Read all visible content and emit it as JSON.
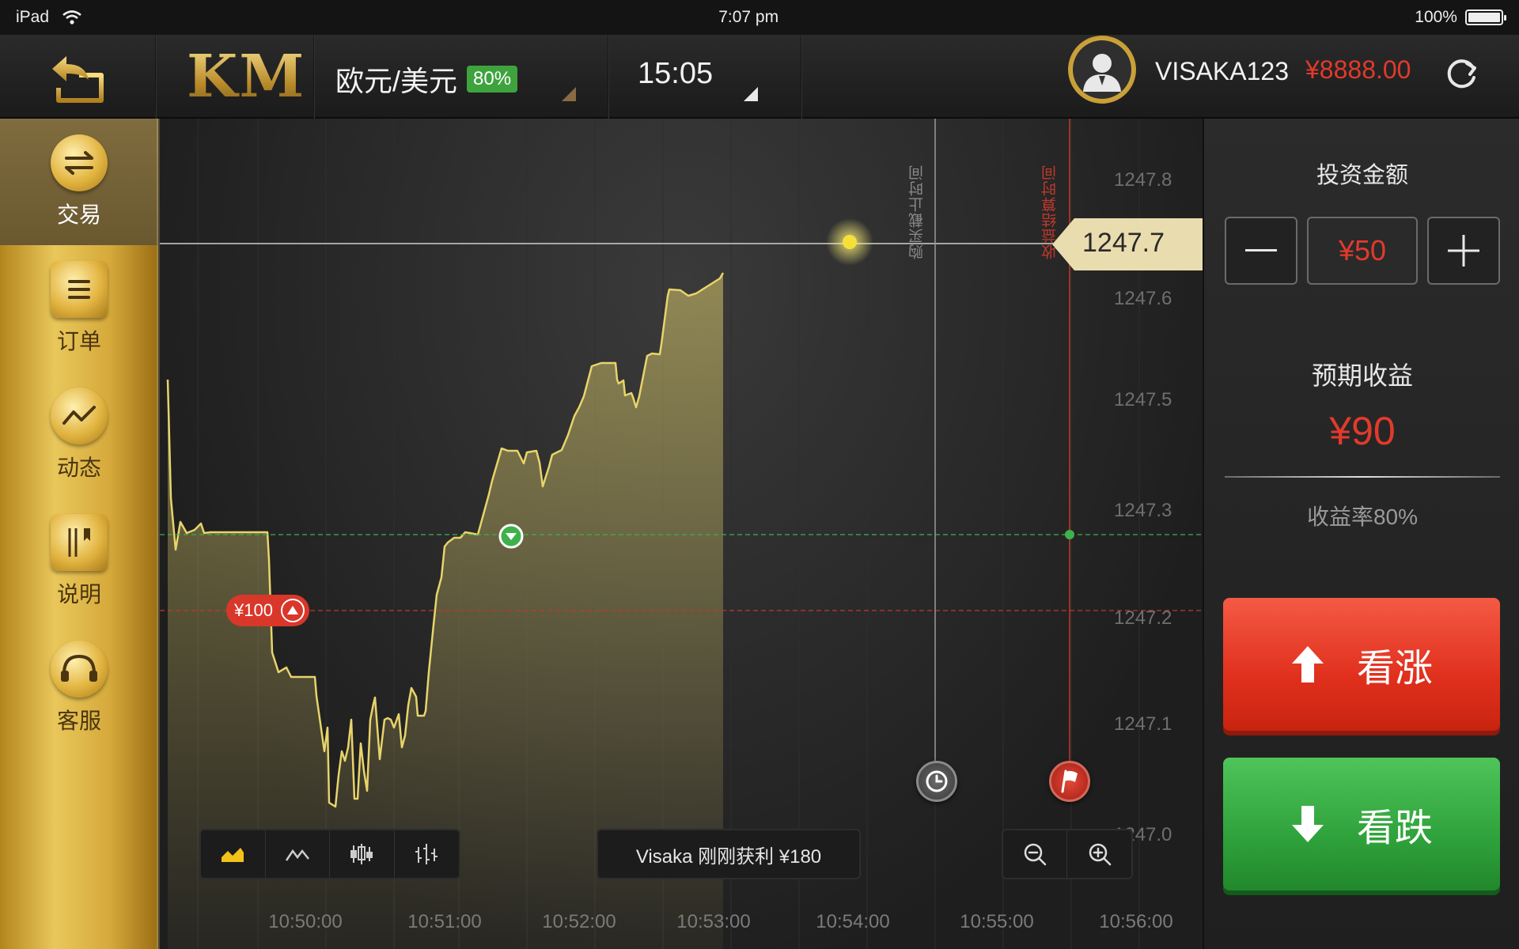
{
  "status_bar": {
    "device": "iPad",
    "time": "7:07 pm",
    "battery": "100%"
  },
  "header": {
    "logo": "KM",
    "pair_name": "欧元/美元",
    "pair_rate": "80%",
    "period": "15:05",
    "username": "VISAKA123",
    "balance": "¥8888.00"
  },
  "sidebar": {
    "items": [
      {
        "label": "交易",
        "icon": "exchange-icon",
        "active": true
      },
      {
        "label": "订单",
        "icon": "order-list-icon",
        "active": false
      },
      {
        "label": "动态",
        "icon": "trend-icon",
        "active": false
      },
      {
        "label": "说明",
        "icon": "book-icon",
        "active": false
      },
      {
        "label": "客服",
        "icon": "headset-icon",
        "active": false
      }
    ]
  },
  "chart": {
    "current_price": "1247.7",
    "entry_label": "¥100",
    "buy_deadline_label": "购买截止时间",
    "expiry_label": "收益结算时间",
    "ticker_text": "Visaka 刚刚获利 ¥180",
    "y_ticks": [
      "1247.8",
      "1247.6",
      "1247.5",
      "1247.3",
      "1247.2",
      "1247.1",
      "1247.0"
    ],
    "x_ticks": [
      "10:50:00",
      "10:51:00",
      "10:52:00",
      "10:53:00",
      "10:54:00",
      "10:55:00",
      "10:56:00"
    ],
    "chart_types": [
      "area-chart-icon",
      "line-chart-icon",
      "candlestick-icon",
      "ohlc-icon"
    ],
    "colors": {
      "line": "#e8d46a",
      "entry": "#d9372a",
      "current": "#f5e03a",
      "mid": "#3fb04c"
    }
  },
  "panel": {
    "invest_title": "投资金额",
    "amount": "¥50",
    "profit_title": "预期收益",
    "profit_value": "¥90",
    "rate_text": "收益率80%",
    "call_label": "看涨",
    "put_label": "看跌",
    "colors": {
      "call": "#e0301d",
      "put": "#2fa23b",
      "accent": "#e23a2c"
    }
  }
}
